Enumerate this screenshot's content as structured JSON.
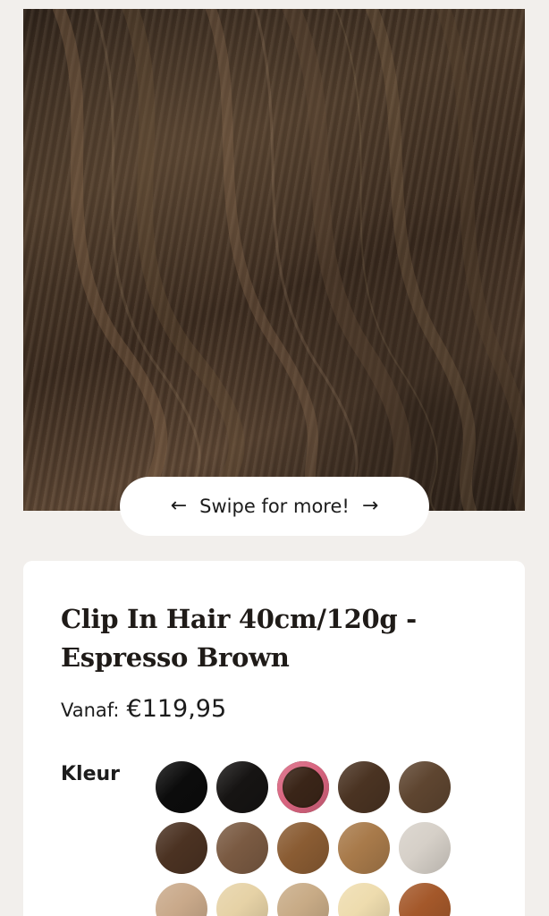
{
  "gallery": {
    "swipe_text": "Swipe for more!"
  },
  "product": {
    "title_line1": "Clip In Hair 40cm/120g -",
    "title_line2": "Espresso Brown",
    "price_label": "Vanaf:",
    "price_value": "€119,95"
  },
  "color_picker": {
    "label": "Kleur",
    "selected_index": 2,
    "swatch_colors": [
      "#0c0c0c",
      "#161413",
      "#3a2518",
      "#4a3322",
      "#5e4530",
      "#4b3222",
      "#7a5a42",
      "#8a5c33",
      "#a87a4a",
      "#d6d0c8",
      "#c9a98a",
      "#e6d2a6",
      "#c8ab86",
      "#eedcae",
      "#a4582a"
    ]
  }
}
